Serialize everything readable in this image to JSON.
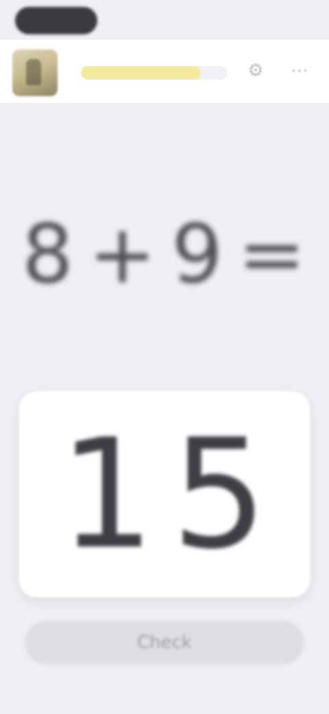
{
  "status_bar": {
    "pill_label": ""
  },
  "header": {
    "progress": 0.82,
    "settings_icon": "gear-icon",
    "more_icon": "more-icon"
  },
  "question": {
    "left_operand": "8",
    "operator": "+",
    "right_operand": "9",
    "equals": "="
  },
  "answer": {
    "value": "15"
  },
  "submit": {
    "label": "Check"
  },
  "colors": {
    "background": "#efeef3",
    "header_bg": "#ffffff",
    "progress": "#f3ea9d",
    "text": "#4e4e53",
    "button_bg": "#deddE3"
  }
}
